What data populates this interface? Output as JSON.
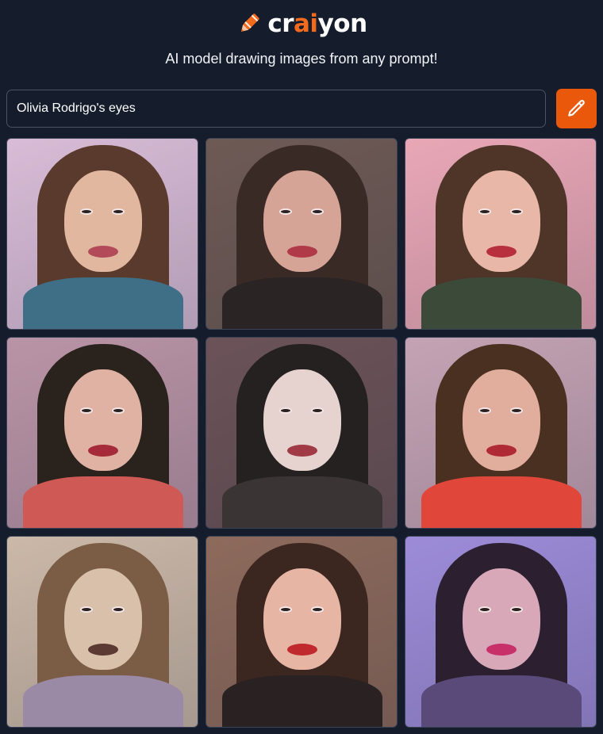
{
  "header": {
    "logo_prefix": "cr",
    "logo_accent": "ai",
    "logo_suffix": "yon",
    "tagline": "AI model drawing images from any prompt!"
  },
  "prompt": {
    "value": "Olivia Rodrigo's eyes",
    "button_icon": "pencil-icon"
  },
  "colors": {
    "background": "#151c2c",
    "accent": "#ea580c",
    "input_border": "#4a5263"
  },
  "images": [
    {
      "bg": "#d9bcd7",
      "hair": "#5a3a2c",
      "skin": "#e2b7a0",
      "shirt": "#3f6f86",
      "lips": "#b24a5a"
    },
    {
      "bg": "#6e5a55",
      "hair": "#3a2a26",
      "skin": "#d6a497",
      "shirt": "#2a2424",
      "lips": "#b03a48"
    },
    {
      "bg": "#e9a7b6",
      "hair": "#4e3528",
      "skin": "#e8b7a8",
      "shirt": "#3c4a3a",
      "lips": "#b8303e"
    },
    {
      "bg": "#b994a6",
      "hair": "#2a221c",
      "skin": "#e0b2a3",
      "shirt": "#cf5a55",
      "lips": "#a52a3a"
    },
    {
      "bg": "#6b5358",
      "hair": "#252121",
      "skin": "#e6d3cf",
      "shirt": "#3a3434",
      "lips": "#a03a44"
    },
    {
      "bg": "#c4a3b4",
      "hair": "#4a3020",
      "skin": "#e1ae9e",
      "shirt": "#e0473a",
      "lips": "#b02a36"
    },
    {
      "bg": "#cbb8a8",
      "hair": "#7b5d45",
      "skin": "#d9c0aa",
      "shirt": "#9b8aa6",
      "lips": "#5a3a32"
    },
    {
      "bg": "#8d6a5c",
      "hair": "#3c2620",
      "skin": "#e6b5a4",
      "shirt": "#2a2222",
      "lips": "#c02a2e"
    },
    {
      "bg": "#9d8bd8",
      "hair": "#2c2030",
      "skin": "#d8a8b8",
      "shirt": "#5a4a7a",
      "lips": "#c8306a"
    }
  ]
}
